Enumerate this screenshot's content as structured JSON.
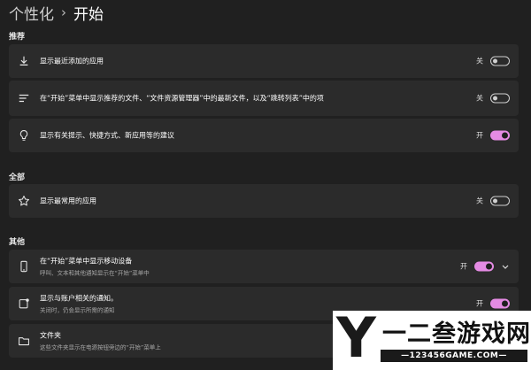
{
  "header": {
    "parent": "个性化",
    "current": "开始"
  },
  "sections": {
    "recommended": "推荐",
    "all": "全部",
    "other": "其他"
  },
  "rows": {
    "recent_apps": {
      "label": "显示最近添加的应用",
      "state": "关",
      "on": false,
      "icon": "download-icon"
    },
    "recommended_files": {
      "label": "在“开始”菜单中显示推荐的文件、“文件资源管理器”中的最新文件，以及“跳转列表”中的项",
      "state": "关",
      "on": false,
      "icon": "list-icon"
    },
    "tips": {
      "label": "显示有关提示、快捷方式、新应用等的建议",
      "state": "开",
      "on": true,
      "icon": "lightbulb-icon"
    },
    "most_used": {
      "label": "显示最常用的应用",
      "state": "关",
      "on": false,
      "icon": "star-icon"
    },
    "mobile_device": {
      "label": "在“开始”菜单中显示移动设备",
      "sub": "呼叫、文本和其他通知显示在“开始”菜单中",
      "state": "开",
      "on": true,
      "icon": "phone-icon"
    },
    "account_notifications": {
      "label": "显示与账户相关的通知。",
      "sub": "关闭时，仍会显示所需的通知",
      "state": "开",
      "on": true,
      "icon": "notification-icon"
    },
    "folders": {
      "label": "文件夹",
      "sub": "这些文件夹显示在电源按钮旁边的“开始”菜单上",
      "icon": "folder-icon"
    }
  },
  "watermark": {
    "letter": "Y",
    "text": "一二叁游戏网",
    "site": "—123456GAME.COM—"
  },
  "colors": {
    "background": "#202020",
    "card": "#2b2b2b",
    "accent": "#e48be3"
  }
}
